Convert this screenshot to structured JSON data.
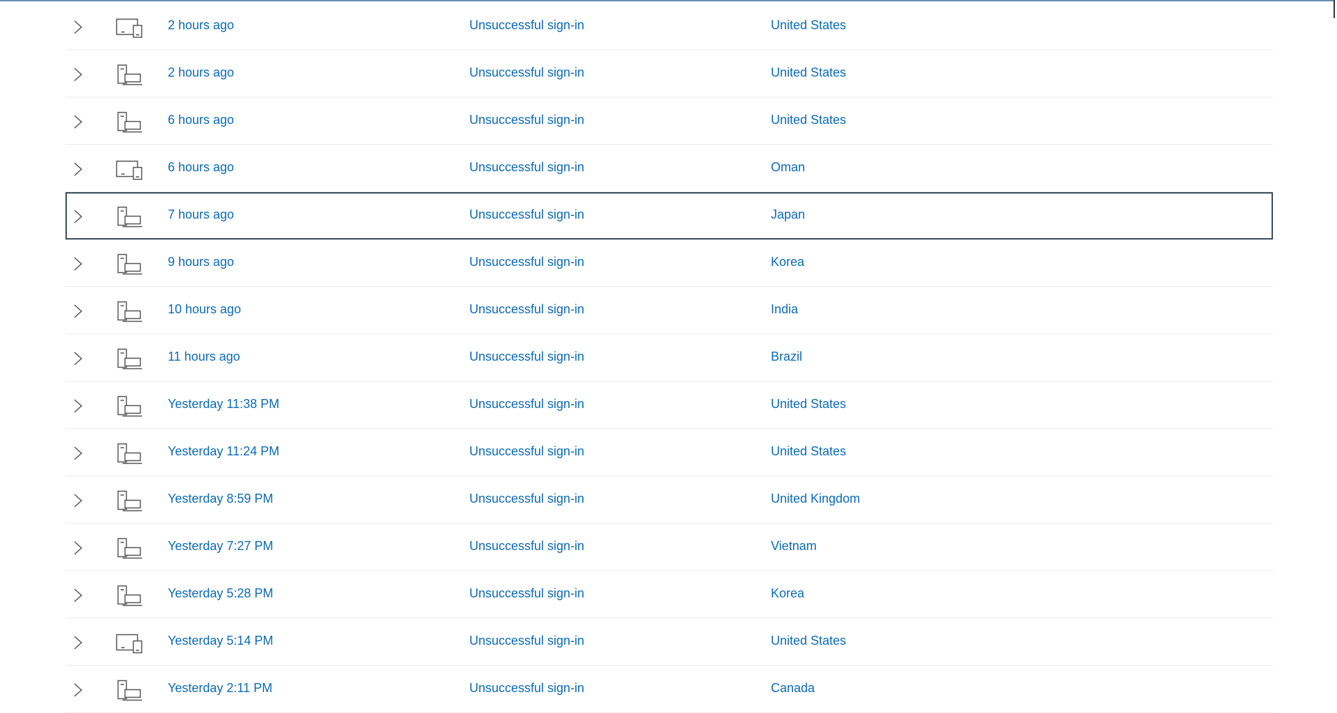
{
  "rows": [
    {
      "time": "2 hours ago",
      "event": "Unsuccessful sign-in",
      "location": "United States",
      "device": "devices-icon"
    },
    {
      "time": "2 hours ago",
      "event": "Unsuccessful sign-in",
      "location": "United States",
      "device": "desktop-icon"
    },
    {
      "time": "6 hours ago",
      "event": "Unsuccessful sign-in",
      "location": "United States",
      "device": "desktop-icon"
    },
    {
      "time": "6 hours ago",
      "event": "Unsuccessful sign-in",
      "location": "Oman",
      "device": "devices-icon"
    },
    {
      "time": "7 hours ago",
      "event": "Unsuccessful sign-in",
      "location": "Japan",
      "device": "desktop-icon"
    },
    {
      "time": "9 hours ago",
      "event": "Unsuccessful sign-in",
      "location": "Korea",
      "device": "desktop-icon"
    },
    {
      "time": "10 hours ago",
      "event": "Unsuccessful sign-in",
      "location": "India",
      "device": "desktop-icon"
    },
    {
      "time": "11 hours ago",
      "event": "Unsuccessful sign-in",
      "location": "Brazil",
      "device": "desktop-icon"
    },
    {
      "time": "Yesterday 11:38 PM",
      "event": "Unsuccessful sign-in",
      "location": "United States",
      "device": "desktop-icon"
    },
    {
      "time": "Yesterday 11:24 PM",
      "event": "Unsuccessful sign-in",
      "location": "United States",
      "device": "desktop-icon"
    },
    {
      "time": "Yesterday 8:59 PM",
      "event": "Unsuccessful sign-in",
      "location": "United Kingdom",
      "device": "desktop-icon"
    },
    {
      "time": "Yesterday 7:27 PM",
      "event": "Unsuccessful sign-in",
      "location": "Vietnam",
      "device": "desktop-icon"
    },
    {
      "time": "Yesterday 5:28 PM",
      "event": "Unsuccessful sign-in",
      "location": "Korea",
      "device": "desktop-icon"
    },
    {
      "time": "Yesterday 5:14 PM",
      "event": "Unsuccessful sign-in",
      "location": "United States",
      "device": "devices-icon"
    },
    {
      "time": "Yesterday 2:11 PM",
      "event": "Unsuccessful sign-in",
      "location": "Canada",
      "device": "desktop-icon"
    }
  ],
  "colors": {
    "link": "#0b6ab8",
    "icon": "#555555",
    "divider": "#ededed",
    "focus": "#3a4a5a"
  }
}
